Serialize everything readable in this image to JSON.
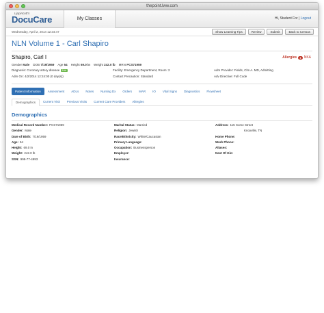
{
  "browser": {
    "title": "thepoint.lww.com"
  },
  "header": {
    "logo_small": "Lippincott's",
    "logo_big": "DocuCare",
    "classes_tab": "My Classes",
    "user_greeting": "Hi, Student For",
    "logout": "Logout"
  },
  "toolbar": {
    "date": "Wednesday, April 2, 2014 12:34:47",
    "buttons": [
      "Show Learning Tips",
      "Review",
      "Submit",
      "Back to Census"
    ]
  },
  "volume_title": "NLN Volume 1 - Carl Shapiro",
  "patient": {
    "name": "Shapiro, Carl I",
    "allergies_label": "Allergies",
    "allergies_count": "1",
    "allergies_value": "NKA",
    "gender_label": "Gender",
    "gender": "Male",
    "dob_label": "DOB",
    "dob": "7/19/1959",
    "age_label": "Age",
    "age": "54",
    "height_label": "Height",
    "height": "69.0 in",
    "weight_label": "Weight",
    "weight": "242.0 lb",
    "mrn_label": "MRN",
    "mrn": "PCS71959",
    "diagnosis": "Diagnosis: Coronary artery disease",
    "diagnosis_tag": "Edit",
    "facility": "Facility: Emergency Department, Room: 2",
    "adm_provider": "Adm Provider: Fields, Clm A. MD, Admitting",
    "adm_on": "Adm On: 4/2/2014 12:24:00 (0 day(s))",
    "contact_precaution": "Contact Precaution: Standard",
    "adv_directive": "Adv Directive: Full Code"
  },
  "nav_tabs": [
    "Patient Information",
    "Assessment",
    "ADLs",
    "Notes",
    "Nursing Dx",
    "Orders",
    "MAR",
    "IO",
    "Vital Signs",
    "Diagnostics",
    "Flowsheet"
  ],
  "sub_tabs": [
    "Demographics",
    "Current Visit",
    "Previous Visits",
    "Current Care Providers",
    "Allergies"
  ],
  "demographics": {
    "title": "Demographics",
    "col1": [
      {
        "label": "Medical Record Number:",
        "value": "PCS71959"
      },
      {
        "label": "Gender:",
        "value": "Male"
      },
      {
        "label": "Date of Birth:",
        "value": "7/19/1959"
      },
      {
        "label": "Age:",
        "value": "54"
      },
      {
        "label": "Height:",
        "value": "69.0 in"
      },
      {
        "label": "Weight:",
        "value": "242.0 lb"
      },
      {
        "label": "SSN:",
        "value": "999-77-4993"
      }
    ],
    "col2": [
      {
        "label": "Marital Status:",
        "value": "Married"
      },
      {
        "label": "Religion:",
        "value": "Jewish"
      },
      {
        "label": "Race/Ethnicity:",
        "value": "White/Caucasian"
      },
      {
        "label": "Primary Language:",
        "value": ""
      },
      {
        "label": "Occupation:",
        "value": "Businessperson"
      },
      {
        "label": "Employer:",
        "value": ""
      },
      {
        "label": "Insurance:",
        "value": ""
      }
    ],
    "col3": [
      {
        "label": "Address:",
        "value": "115 Some Street"
      },
      {
        "label": "",
        "value": "Knoxville, TN"
      },
      {
        "label": "Home Phone:",
        "value": ""
      },
      {
        "label": "Work Phone:",
        "value": ""
      },
      {
        "label": "Aliases:",
        "value": ""
      },
      {
        "label": "Next Of Kin:",
        "value": ""
      }
    ]
  },
  "colors": {
    "accent": "#2f6fb3",
    "allergy": "#c0392b",
    "tag": "#6bb64a"
  }
}
